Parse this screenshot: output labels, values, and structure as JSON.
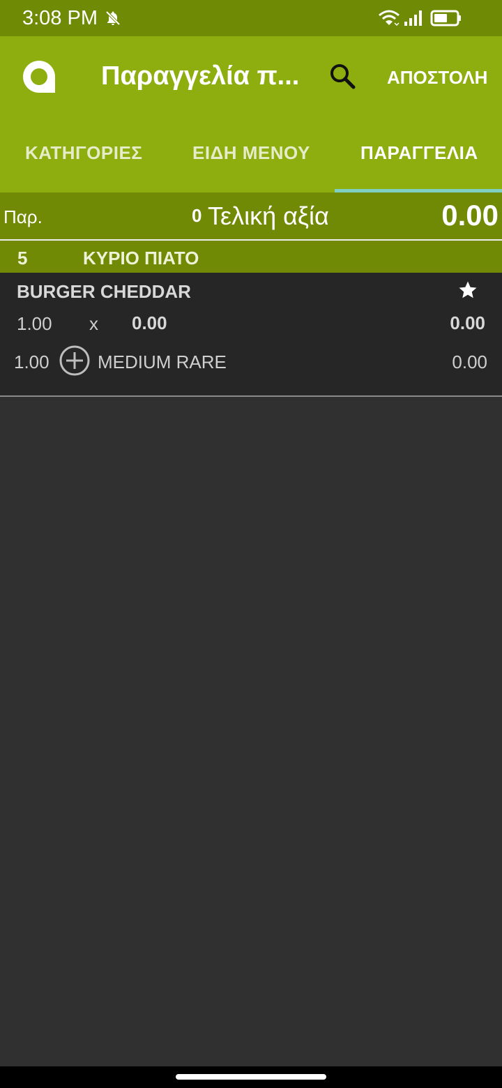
{
  "status_bar": {
    "time": "3:08 PM",
    "icons": [
      "bell-off-icon",
      "wifi-icon",
      "signal-icon",
      "battery-icon"
    ]
  },
  "app_bar": {
    "title": "Παραγγελία π...",
    "send_label": "ΑΠΟΣΤΟΛΗ",
    "icons": [
      "app-logo-icon",
      "search-icon"
    ]
  },
  "tabs": [
    {
      "label": "ΚΑΤΗΓΟΡΙΕΣ",
      "selected": false
    },
    {
      "label": "ΕΙΔΗ ΜΕΝΟΥ",
      "selected": false
    },
    {
      "label": "ΠΑΡΑΓΓΕΛΙΑ",
      "selected": true
    }
  ],
  "summary": {
    "label": "Παρ.",
    "count": "0",
    "total_label": "Τελική αξία",
    "total": "0.00"
  },
  "category": {
    "number": "5",
    "name": "ΚΥΡΙΟ ΠΙΑΤΟ"
  },
  "order_item": {
    "name": "BURGER CHEDDAR",
    "quantity": "1.00",
    "times": "x",
    "unit_price": "0.00",
    "line_total": "0.00",
    "modifier": {
      "quantity": "1.00",
      "name": "MEDIUM RARE",
      "price": "0.00"
    }
  },
  "colors": {
    "status_bar": "#6f8a05",
    "app_bar": "#8dae0e",
    "summary_bar": "#718a06",
    "tab_indicator": "#7fcfc2",
    "item_background": "#262626",
    "page_background": "#303030"
  }
}
